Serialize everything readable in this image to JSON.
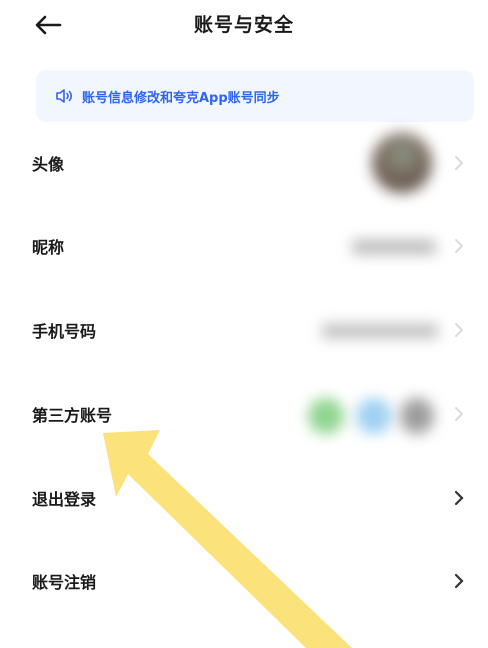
{
  "header": {
    "title": "账号与安全"
  },
  "notice": {
    "text": "账号信息修改和夸克App账号同步"
  },
  "rows": [
    {
      "label": "头像"
    },
    {
      "label": "昵称"
    },
    {
      "label": "手机号码"
    },
    {
      "label": "第三方账号"
    },
    {
      "label": "退出登录"
    },
    {
      "label": "账号注销"
    }
  ],
  "colors": {
    "accent": "#2f66f0",
    "notice_bg": "#f2f6fe",
    "arrow": "#fbe27a"
  },
  "icons": {
    "back": "arrow-left-icon",
    "notice": "speaker-icon",
    "chevron": "chevron-right-icon"
  }
}
